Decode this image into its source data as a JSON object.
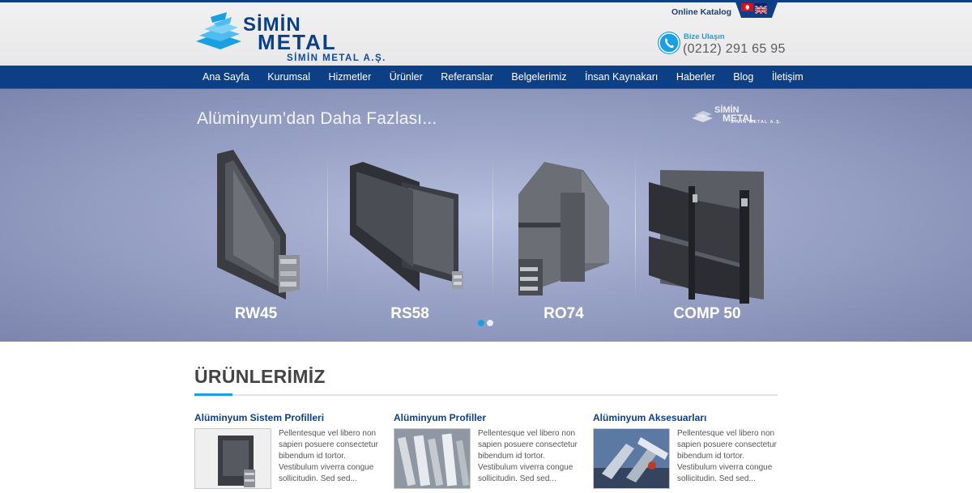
{
  "brand": {
    "name_top": "SİMİN",
    "name_bottom": "METAL",
    "company": "SİMİN METAL A.Ş.",
    "accent": "#1aa0e2",
    "primary": "#0d3f86"
  },
  "header": {
    "catalog_label": "Online Katalog",
    "languages": [
      "tr-flag-icon",
      "en-flag-icon"
    ],
    "contact_label": "Bize Ulaşın",
    "contact_phone": "(0212) 291 65 95",
    "phone_icon": "phone-icon"
  },
  "nav": {
    "items": [
      {
        "label": "Ana Sayfa"
      },
      {
        "label": "Kurumsal"
      },
      {
        "label": "Hizmetler"
      },
      {
        "label": "Ürünler"
      },
      {
        "label": "Referanslar"
      },
      {
        "label": "Belgelerimiz"
      },
      {
        "label": "İnsan Kaynakarı"
      },
      {
        "label": "Haberler"
      },
      {
        "label": "Blog"
      },
      {
        "label": "İletişim"
      }
    ]
  },
  "slider": {
    "heading": "Alüminyum’dan Daha Fazlası...",
    "logo_name_top": "SİMİN",
    "logo_name_bottom": "METAL",
    "logo_company": "SİMİN METAL A.Ş.",
    "products": [
      {
        "label": "RW45"
      },
      {
        "label": "RS58"
      },
      {
        "label": "RO74"
      },
      {
        "label": "COMP 50"
      }
    ],
    "slide_count": 2,
    "active_slide": 1
  },
  "products_section": {
    "title": "ÜRÜNLERİMİZ",
    "cards": [
      {
        "title": "Alüminyum Sistem Profilleri",
        "text": "Pellentesque vel libero non sapien posuere consectetur bibendum id tortor. Vestibulum viverra congue sollicitudin. Sed sed..."
      },
      {
        "title": "Alüminyum Profiller",
        "text": "Pellentesque vel libero non sapien posuere consectetur bibendum id tortor. Vestibulum viverra congue sollicitudin. Sed sed..."
      },
      {
        "title": "Alüminyum Aksesuarları",
        "text": "Pellentesque vel libero non sapien posuere consectetur bibendum id tortor. Vestibulum viverra congue sollicitudin. Sed sed..."
      }
    ]
  }
}
